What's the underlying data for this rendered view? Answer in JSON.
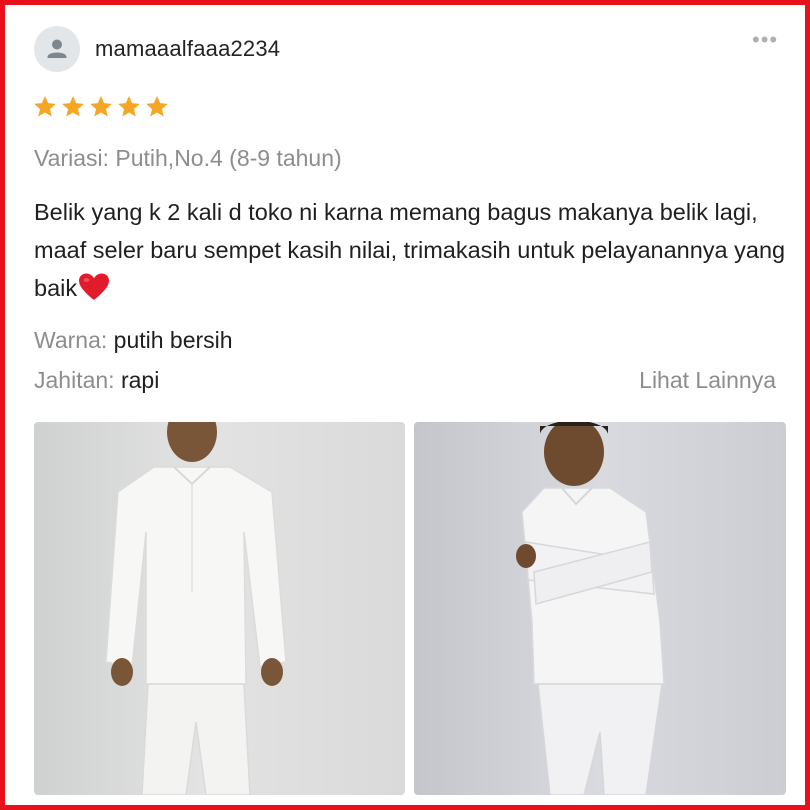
{
  "review": {
    "username": "mamaaalfaaa2234",
    "more_label": "•••",
    "rating": 5,
    "rating_max": 5,
    "variation": "Variasi: Putih,No.4 (8-9 tahun)",
    "text": "Belik yang k 2 kali d toko ni karna memang bagus makanya belik lagi, maaf seler baru sempet kasih nilai, trimakasih untuk pelayanannya yang baik",
    "attributes": [
      {
        "label": "Warna:",
        "value": "putih bersih"
      },
      {
        "label": "Jahitan:",
        "value": "rapi"
      }
    ],
    "see_more": "Lihat Lainnya"
  },
  "icons": {
    "avatar": "user-icon",
    "more": "more-horizontal-icon",
    "star": "star-icon",
    "heart": "heart-emoji"
  },
  "colors": {
    "border": "#e8111b",
    "star": "#f5a623",
    "muted_text": "#8d8d8d",
    "body_text": "#1f1f1f"
  }
}
